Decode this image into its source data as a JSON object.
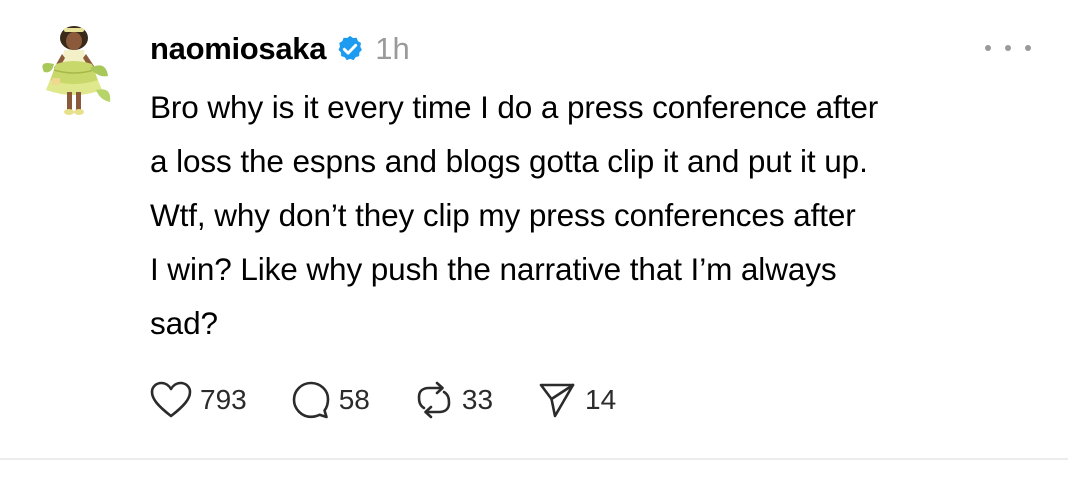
{
  "post": {
    "username": "naomiosaka",
    "verified": true,
    "timestamp": "1h",
    "text_lines": [
      "Bro why is it every time I do a press conference after",
      "a loss the espns and blogs gotta clip it and put it up.",
      "Wtf, why don’t they clip my press conferences after",
      "I win? Like why push the narrative that I’m always",
      "sad?"
    ],
    "actions": {
      "likes": "793",
      "replies": "58",
      "reposts": "33",
      "shares": "14"
    }
  },
  "icons": {
    "verified": "verified-badge-icon",
    "more": "more-options-icon",
    "like": "heart-icon",
    "reply": "comment-bubble-icon",
    "repost": "repost-icon",
    "share": "send-icon"
  },
  "colors": {
    "verified_blue": "#1d9bf0",
    "muted_gray": "#9a9a9a"
  }
}
